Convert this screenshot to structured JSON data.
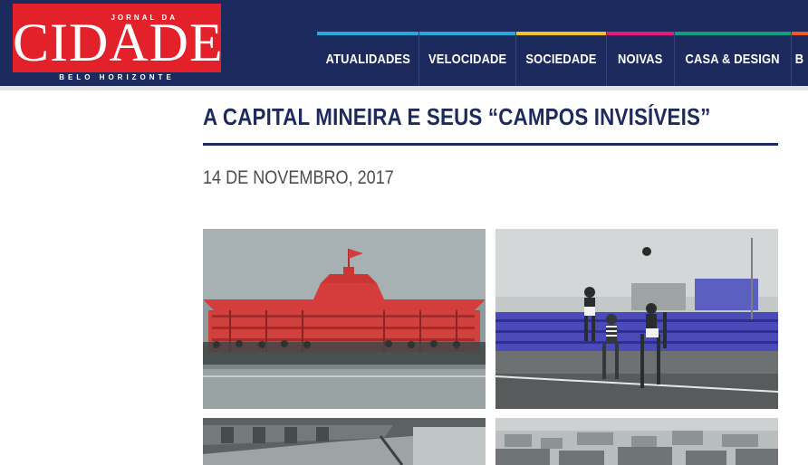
{
  "site": {
    "logo_top": "JORNAL DA",
    "logo_main": "CIDADE",
    "logo_city": "BELO HORIZONTE"
  },
  "nav": {
    "items": [
      {
        "label": "ATUALIDADES",
        "color": "#29a8e0"
      },
      {
        "label": "VELOCIDADE",
        "color": "#29a8e0"
      },
      {
        "label": "SOCIEDADE",
        "color": "#f2c12e"
      },
      {
        "label": "NOIVAS",
        "color": "#e6197d"
      },
      {
        "label": "CASA & DESIGN",
        "color": "#139c7e"
      },
      {
        "label": "B",
        "color": "#f05a28"
      }
    ]
  },
  "article": {
    "title": "A CAPITAL MINEIRA E SEUS “CAMPOS INVISÍVEIS”",
    "date": "14 DE NOVEMBRO, 2017"
  },
  "colors": {
    "header_bg": "#1c2a5e",
    "logo_red": "#e3212a",
    "title_blue": "#1c2a5e"
  }
}
